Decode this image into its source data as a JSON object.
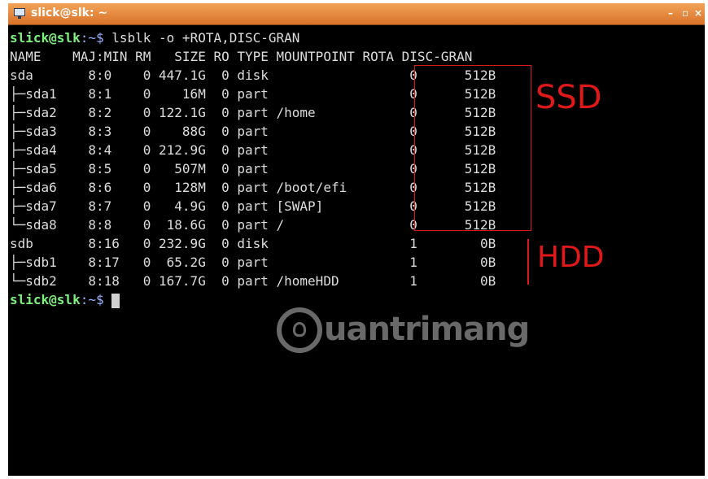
{
  "window": {
    "title": "slick@slk: ~",
    "min_label": "–",
    "max_label": "▫",
    "close_label": "×"
  },
  "prompt": {
    "user_host": "slick@slk",
    "path_sep": ":~$ ",
    "command": "lsblk -o +ROTA,DISC-GRAN"
  },
  "header": "NAME    MAJ:MIN RM   SIZE RO TYPE MOUNTPOINT ROTA DISC-GRAN",
  "rows": [
    "sda       8:0    0 447.1G  0 disk                  0      512B",
    "├─sda1    8:1    0    16M  0 part                  0      512B",
    "├─sda2    8:2    0 122.1G  0 part /home            0      512B",
    "├─sda3    8:3    0    88G  0 part                  0      512B",
    "├─sda4    8:4    0 212.9G  0 part                  0      512B",
    "├─sda5    8:5    0   507M  0 part                  0      512B",
    "├─sda6    8:6    0   128M  0 part /boot/efi        0      512B",
    "├─sda7    8:7    0   4.9G  0 part [SWAP]           0      512B",
    "└─sda8    8:8    0  18.6G  0 part /                0      512B",
    "sdb       8:16   0 232.9G  0 disk                  1        0B",
    "├─sdb1    8:17   0  65.2G  0 part                  1        0B",
    "└─sdb2    8:18   0 167.7G  0 part /homeHDD         1        0B"
  ],
  "annotations": {
    "ssd": "SSD",
    "hdd": "HDD"
  },
  "watermark": {
    "text": "uantrimang"
  },
  "colors": {
    "prompt": "#7df27d",
    "path": "#9cb2ff",
    "annotation": "#e01818",
    "titlebar": "#e8893a"
  },
  "icons": {
    "titlebar": "terminal-icon"
  }
}
